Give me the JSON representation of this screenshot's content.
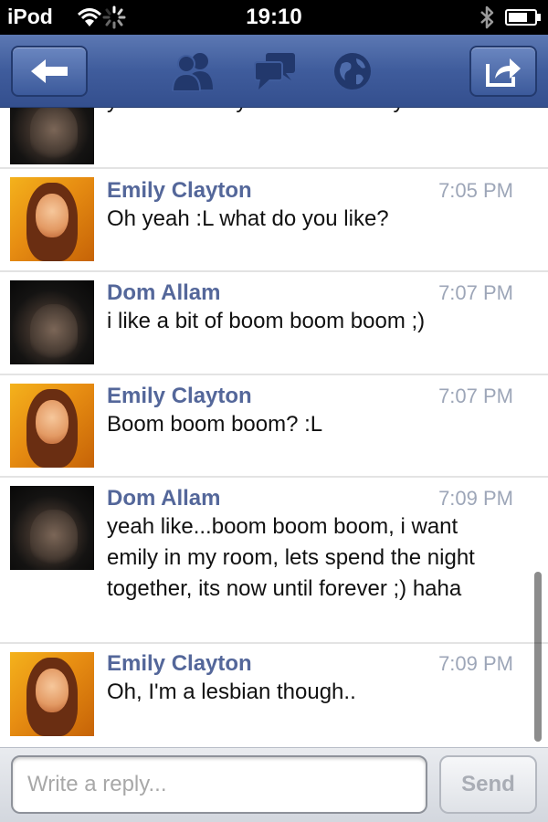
{
  "statusbar": {
    "carrier": "iPod",
    "time": "19:10",
    "icons": [
      "wifi-icon",
      "activity-spinner-icon",
      "bluetooth-icon",
      "battery-icon"
    ]
  },
  "navbar": {
    "icons": [
      "back-arrow-icon",
      "friends-icon",
      "messages-icon",
      "globe-icon",
      "share-icon"
    ],
    "colors": {
      "bar": "#3f5c9c",
      "button": "#4e6cab"
    }
  },
  "messages": [
    {
      "sender": "",
      "time": "",
      "text": "yeah i asked you what music you liked",
      "avatar": "dom-allam-photo"
    },
    {
      "sender": "Emily Clayton",
      "time": "7:05 PM",
      "text": "Oh yeah :L what do you like?",
      "avatar": "emily-clayton-photo"
    },
    {
      "sender": "Dom Allam",
      "time": "7:07 PM",
      "text": "i like a bit of boom boom boom ;)",
      "avatar": "dom-allam-photo"
    },
    {
      "sender": "Emily Clayton",
      "time": "7:07 PM",
      "text": "Boom boom boom? :L",
      "avatar": "emily-clayton-photo"
    },
    {
      "sender": "Dom Allam",
      "time": "7:09 PM",
      "text": "yeah like...boom boom boom, i want emily in my room, lets spend the night together, its now until forever ;) haha",
      "avatar": "dom-allam-photo"
    },
    {
      "sender": "Emily Clayton",
      "time": "7:09 PM",
      "text": "Oh, I'm a lesbian though..",
      "avatar": "emily-clayton-photo"
    }
  ],
  "reply": {
    "placeholder": "Write a reply...",
    "value": "",
    "send_label": "Send"
  },
  "colors": {
    "name": "#54679a",
    "timestamp": "#9da6b8",
    "divider": "#e3e3e3"
  }
}
